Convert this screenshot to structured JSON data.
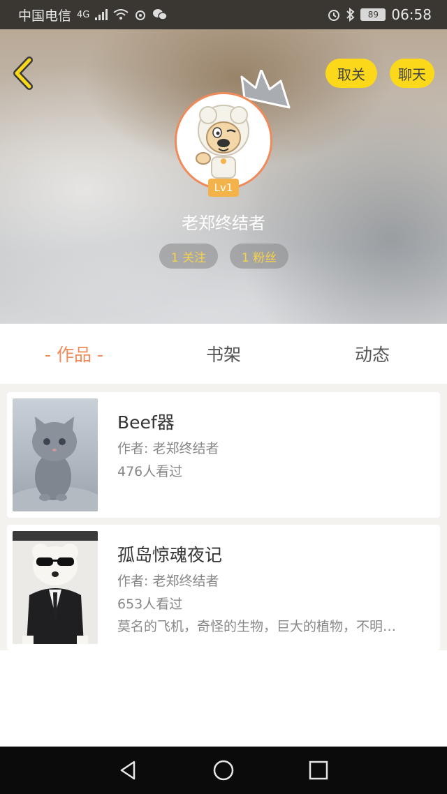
{
  "status_bar": {
    "carrier": "中国电信",
    "network": "4G",
    "battery": "89",
    "time": "06:58"
  },
  "header": {
    "back_icon": "chevron-left-icon",
    "unfollow_label": "取关",
    "chat_label": "聊天",
    "username": "老郑终结者",
    "level": "Lv1",
    "following": "1 关注",
    "fans": "1 粉丝",
    "accent_color": "#fbd91a"
  },
  "tabs": [
    {
      "label": "- 作品 -",
      "active": true
    },
    {
      "label": "书架",
      "active": false
    },
    {
      "label": "动态",
      "active": false
    }
  ],
  "works": [
    {
      "title": "Beef器",
      "author": "作者: 老郑终结者",
      "views": "476人看过",
      "description": "",
      "cover": "gray-kitten-photo"
    },
    {
      "title": "孤岛惊魂夜记",
      "author": "作者: 老郑终结者",
      "views": "653人看过",
      "description": "莫名的飞机，奇怪的生物，巨大的植物，不明…",
      "cover": "bear-in-suit-photo"
    }
  ],
  "nav": {
    "back": "triangle-back-icon",
    "home": "circle-home-icon",
    "recent": "square-recent-icon"
  },
  "colors": {
    "active_tab": "#f08a58",
    "stat_text": "#f5d24a"
  }
}
